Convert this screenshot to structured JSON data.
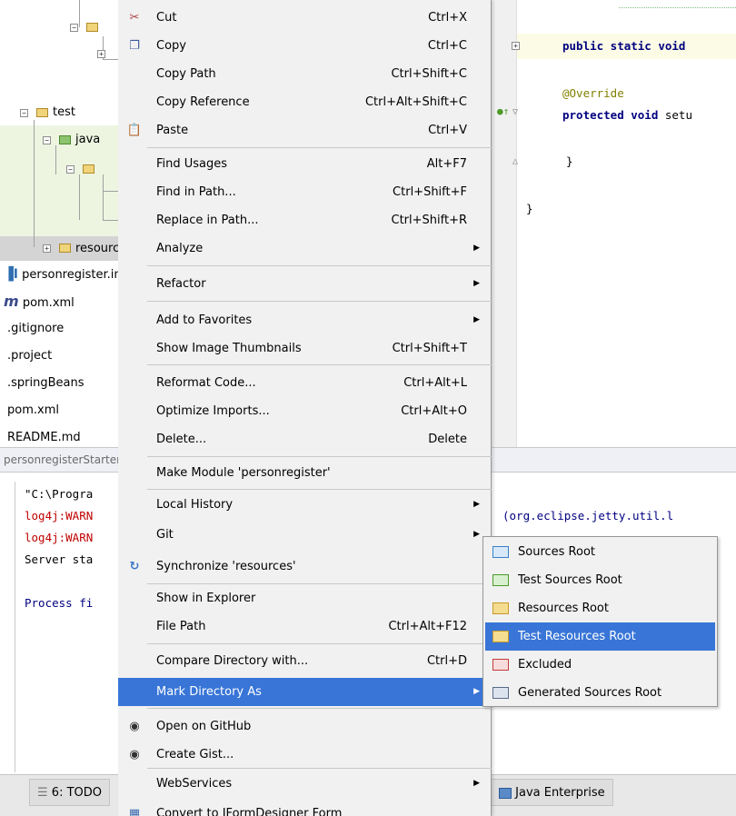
{
  "tree": {
    "items": [
      {
        "label": "test"
      },
      {
        "label": "java"
      },
      {
        "label": "resources"
      },
      {
        "label": "personregister.iml"
      },
      {
        "label": "pom.xml"
      },
      {
        "label": ".gitignore"
      },
      {
        "label": ".project"
      },
      {
        "label": ".springBeans"
      },
      {
        "label": "pom.xml"
      },
      {
        "label": "README.md"
      }
    ]
  },
  "editor": {
    "lines": [
      {
        "kw": "public static void",
        "rest": ""
      },
      {
        "ann": "@Override"
      },
      {
        "kw": "protected void",
        "rest": " setu"
      },
      {
        "plain": "}"
      },
      {
        "plain": "}"
      }
    ]
  },
  "run_panel": {
    "header": "personregisterStarter",
    "console": [
      {
        "text": "\"C:\\Progra",
        "color": "#000000"
      },
      {
        "text": "log4j:WARN",
        "color": "#c00000"
      },
      {
        "text": "log4j:WARN",
        "color": "#c00000"
      },
      {
        "text": "Server sta",
        "color": "#000000"
      },
      {
        "text": "Process fi",
        "color": "#000080"
      }
    ],
    "right_text": "(org.eclipse.jetty.util.l"
  },
  "toolbar": {
    "todo": "6: TODO",
    "java_enterprise": "Java Enterprise"
  },
  "menu": {
    "items": [
      {
        "label": "Cut",
        "shortcut": "Ctrl+X",
        "icon": "scissors-icon"
      },
      {
        "label": "Copy",
        "shortcut": "Ctrl+C",
        "icon": "copy-icon"
      },
      {
        "label": "Copy Path",
        "shortcut": "Ctrl+Shift+C"
      },
      {
        "label": "Copy Reference",
        "shortcut": "Ctrl+Alt+Shift+C"
      },
      {
        "label": "Paste",
        "shortcut": "Ctrl+V",
        "icon": "paste-icon"
      },
      {
        "label": "Find Usages",
        "shortcut": "Alt+F7"
      },
      {
        "label": "Find in Path...",
        "shortcut": "Ctrl+Shift+F"
      },
      {
        "label": "Replace in Path...",
        "shortcut": "Ctrl+Shift+R"
      },
      {
        "label": "Analyze",
        "submenu": true
      },
      {
        "label": "Refactor",
        "submenu": true
      },
      {
        "label": "Add to Favorites",
        "submenu": true
      },
      {
        "label": "Show Image Thumbnails",
        "shortcut": "Ctrl+Shift+T"
      },
      {
        "label": "Reformat Code...",
        "shortcut": "Ctrl+Alt+L"
      },
      {
        "label": "Optimize Imports...",
        "shortcut": "Ctrl+Alt+O"
      },
      {
        "label": "Delete...",
        "shortcut": "Delete"
      },
      {
        "label": "Make Module 'personregister'"
      },
      {
        "label": "Local History",
        "submenu": true
      },
      {
        "label": "Git",
        "submenu": true
      },
      {
        "label": "Synchronize 'resources'",
        "icon": "sync-icon"
      },
      {
        "label": "Show in Explorer"
      },
      {
        "label": "File Path",
        "shortcut": "Ctrl+Alt+F12"
      },
      {
        "label": "Compare Directory with...",
        "shortcut": "Ctrl+D"
      },
      {
        "label": "Mark Directory As",
        "submenu": true,
        "highlighted": true
      },
      {
        "label": "Open on GitHub",
        "icon": "github-icon"
      },
      {
        "label": "Create Gist...",
        "icon": "github-icon"
      },
      {
        "label": "WebServices",
        "submenu": true
      },
      {
        "label": "Convert to JFormDesigner Form",
        "icon": "form-icon"
      }
    ]
  },
  "submenu": {
    "items": [
      {
        "label": "Sources Root",
        "color": "#3b7fc4"
      },
      {
        "label": "Test Sources Root",
        "color": "#4c9a2a"
      },
      {
        "label": "Resources Root",
        "color": "#c89a2a"
      },
      {
        "label": "Test Resources Root",
        "color": "#c89a2a",
        "highlighted": true
      },
      {
        "label": "Excluded",
        "color": "#c43b3b"
      },
      {
        "label": "Generated Sources Root",
        "color": "#5a6a8a"
      }
    ]
  },
  "colors": {
    "highlight": "#3875d7",
    "menu_bg": "#f1f1f1",
    "keyword": "#000080",
    "annotation": "#808000",
    "warn": "#c00000"
  }
}
